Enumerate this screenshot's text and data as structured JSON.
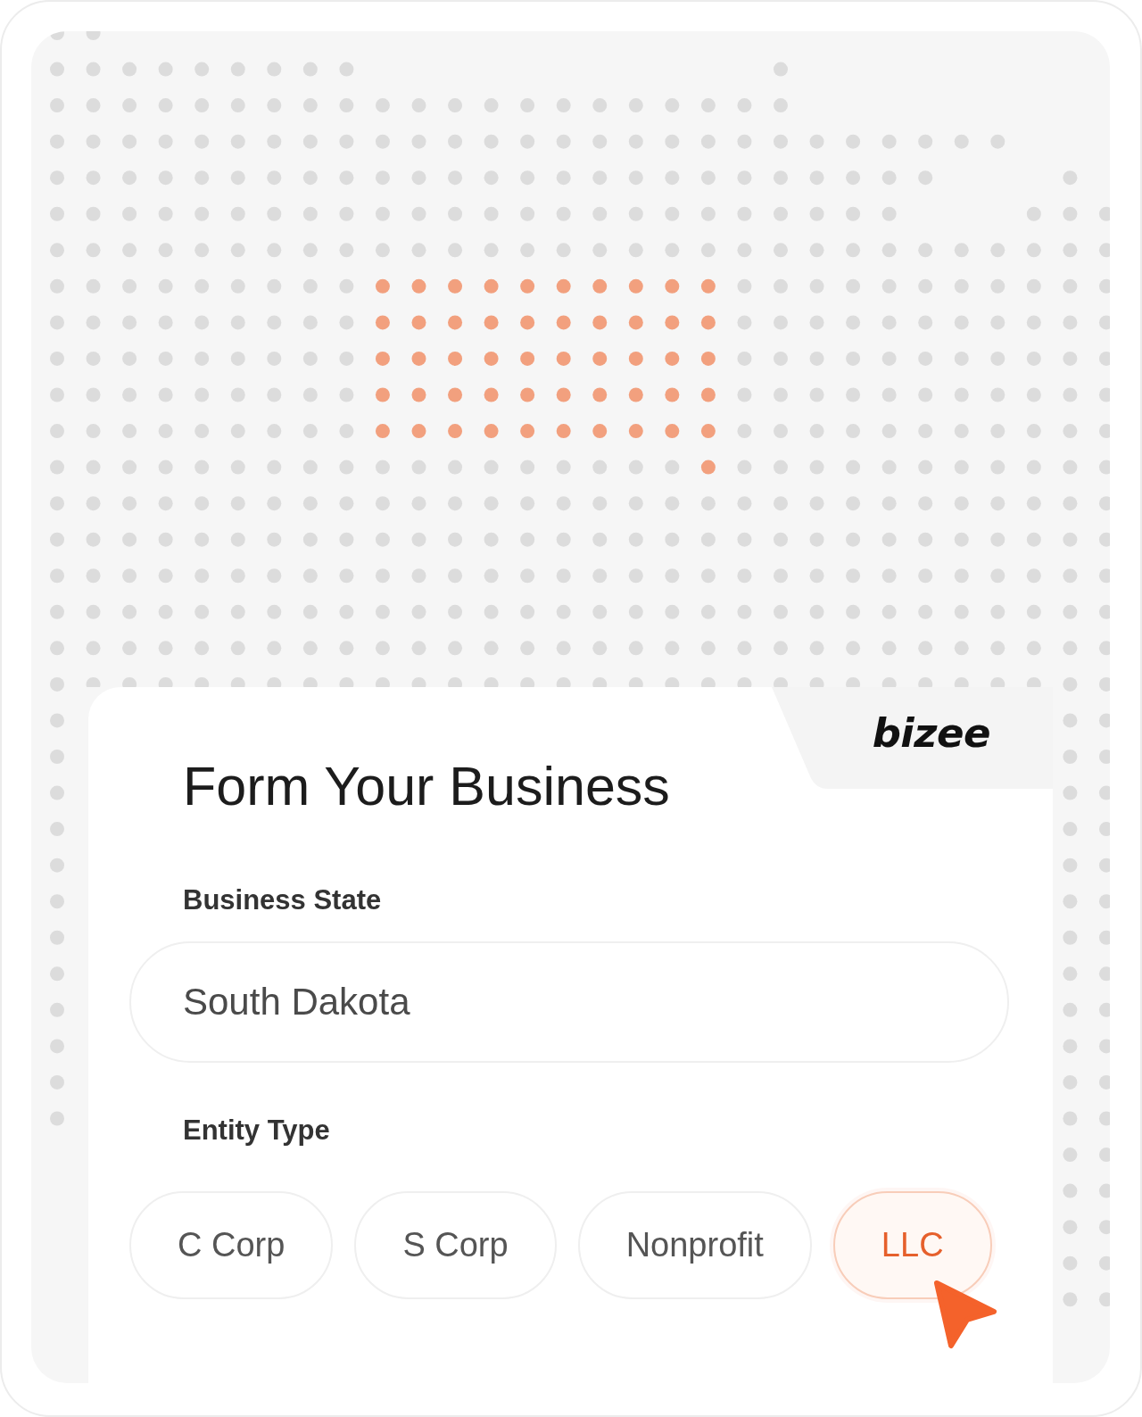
{
  "logo": "bizee",
  "title": "Form Your Business",
  "business_state": {
    "label": "Business State",
    "value": "South Dakota"
  },
  "entity_type": {
    "label": "Entity Type",
    "options": [
      {
        "label": "C Corp",
        "selected": false
      },
      {
        "label": "S Corp",
        "selected": false
      },
      {
        "label": "Nonprofit",
        "selected": false
      },
      {
        "label": "LLC",
        "selected": true
      }
    ]
  }
}
